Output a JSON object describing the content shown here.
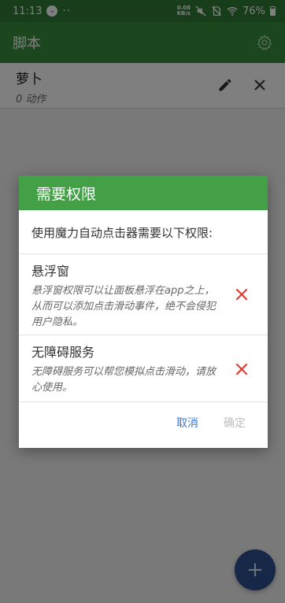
{
  "status_bar": {
    "time": "11:13",
    "more": "··",
    "net_speed_value": "0.08",
    "net_speed_unit": "KB/s",
    "battery": "76%"
  },
  "app_bar": {
    "title": "脚本",
    "settings_icon": "gear-icon"
  },
  "script_list": [
    {
      "name": "萝卜",
      "actions": "0 动作"
    }
  ],
  "dialog": {
    "title": "需要权限",
    "description": "使用魔力自动点击器需要以下权限:",
    "permissions": [
      {
        "title": "悬浮窗",
        "text": "悬浮窗权限可以让面板悬浮在app之上，从而可以添加点击滑动事件，绝不会侵犯用户隐私。",
        "status_icon": "cross-icon"
      },
      {
        "title": "无障碍服务",
        "text": "无障碍服务可以帮您模拟点击滑动，请放心使用。",
        "status_icon": "cross-icon"
      }
    ],
    "cancel_label": "取消",
    "ok_label": "确定"
  },
  "fab": {
    "label": "+"
  },
  "colors": {
    "primary": "#388e3c",
    "dialog_header": "#43a047",
    "accent": "#3a7bd5",
    "error": "#e53935",
    "fab": "#2e4f8f"
  }
}
